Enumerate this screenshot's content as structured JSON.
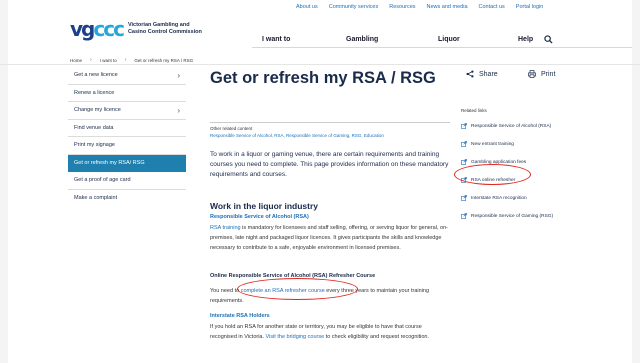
{
  "utility_nav": [
    "About us",
    "Community services",
    "Resources",
    "News and media",
    "Contact us",
    "Portal login"
  ],
  "logo": {
    "mark": "vgccc",
    "line1": "Victorian Gambling and",
    "line2": "Casino Control Commission"
  },
  "main_nav": {
    "want": "I want to",
    "gambling": "Gambling",
    "liquor": "Liquor",
    "help": "Help"
  },
  "breadcrumb": [
    "Home",
    "I want to",
    "Get or refresh my RSA / RSG"
  ],
  "sidebar": [
    {
      "label": "Get a new licence",
      "chevron": true
    },
    {
      "label": "Renew a licence",
      "chevron": false
    },
    {
      "label": "Change my licence",
      "chevron": true
    },
    {
      "label": "Find venue data",
      "chevron": false
    },
    {
      "label": "Print my signage",
      "chevron": false
    },
    {
      "label": "Get or refresh my RSA/ RSG",
      "chevron": false,
      "active": true
    },
    {
      "label": "Get a proof of age card",
      "chevron": false
    },
    {
      "label": "Make a complaint",
      "chevron": false
    }
  ],
  "page": {
    "title": "Get or refresh my RSA / RSG",
    "share": "Share",
    "print": "Print",
    "other_related_label": "Other related content",
    "other_related_links": "Responsible Service of Alcohol, RSA, Responsible Service of Gaming, RSG, Education",
    "intro": "To work in a liquor or gaming venue, there are certain requirements and training courses you need to complete. This page provides information on these mandatory requirements and courses.",
    "h2": "Work in the liquor industry",
    "h3_rsa": "Responsible Service of Alcohol (RSA)",
    "rsa_link": "RSA training",
    "rsa_para": " is mandatory for licensees and staff selling, offering, or serving liquor for general, on-premises, late night and packaged liquor licences. It gives participants the skills and knowledge necessary to contribute to a safe, enjoyable environment in licensed premises.",
    "h3_refresher": "Online Responsible Service of Alcohol (RSA) Refresher Course",
    "refresher_pre": "You need to ",
    "refresher_link": "complete an RSA refresher course",
    "refresher_post": " every three years to maintain your training requirements.",
    "h3_interstate": "Interstate RSA Holders",
    "interstate_pre": "If you hold an RSA for another state or territory, you may be eligible to have that course recognised in Victoria. ",
    "interstate_link": "Visit the bridging course",
    "interstate_post": " to check eligibility and request recognition."
  },
  "related_links": {
    "title": "Related links",
    "items": [
      "Responsible Service of Alcohol (RSA)",
      "New entrant training",
      "Gambling application fees",
      "RSA online refresher",
      "Interstate RSA recognition",
      "Responsible Service of Gaming (RSG)"
    ]
  },
  "colors": {
    "accent": "#1f7fae",
    "link": "#1d6fb8",
    "annotation": "#e0261c"
  }
}
